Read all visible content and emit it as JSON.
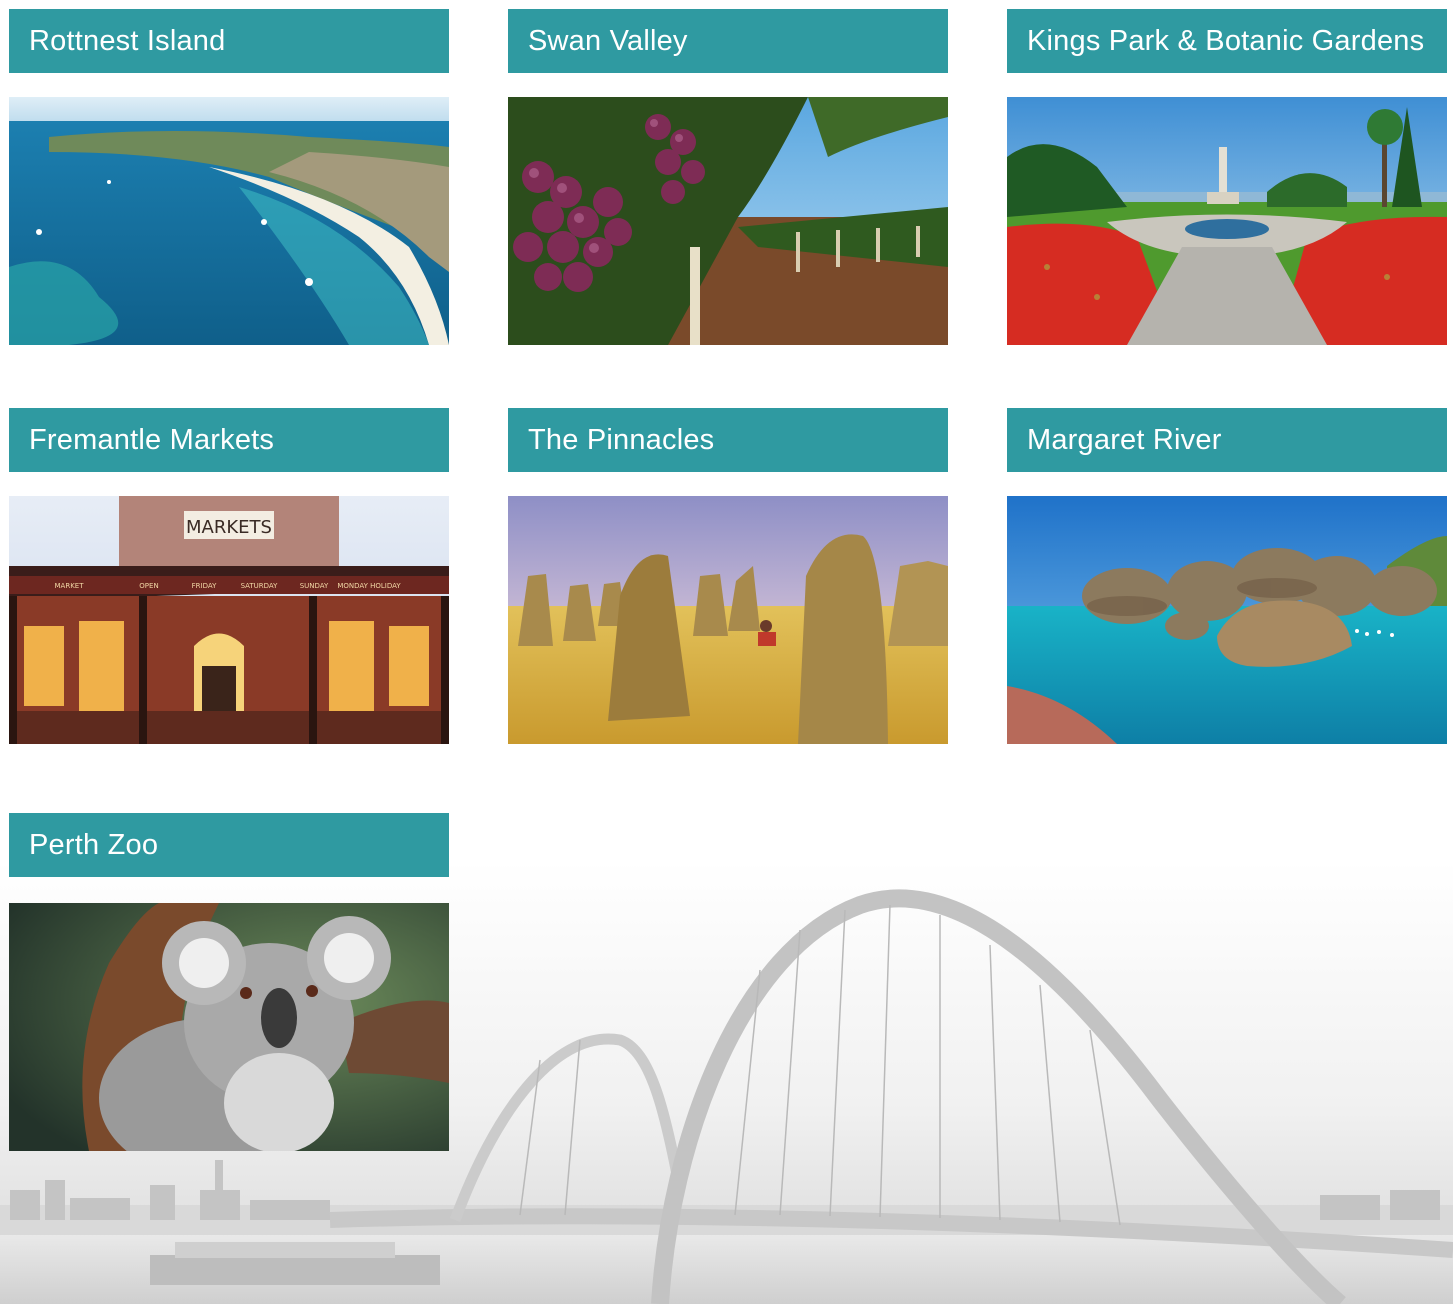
{
  "attractions": [
    {
      "title": "Rottnest Island"
    },
    {
      "title": "Swan Valley"
    },
    {
      "title": "Kings Park & Botanic Gardens"
    },
    {
      "title": "Fremantle Markets"
    },
    {
      "title": "The Pinnacles"
    },
    {
      "title": "Margaret River"
    },
    {
      "title": "Perth Zoo"
    }
  ],
  "photo_signage": {
    "markets_sign": "MARKETS",
    "awning_days": [
      "MARKET",
      "OPEN",
      "FRIDAY",
      "SATURDAY",
      "SUNDAY",
      "MONDAY HOLIDAY"
    ]
  },
  "colors": {
    "header_bg": "#2f9aa1",
    "header_text": "#ffffff"
  }
}
